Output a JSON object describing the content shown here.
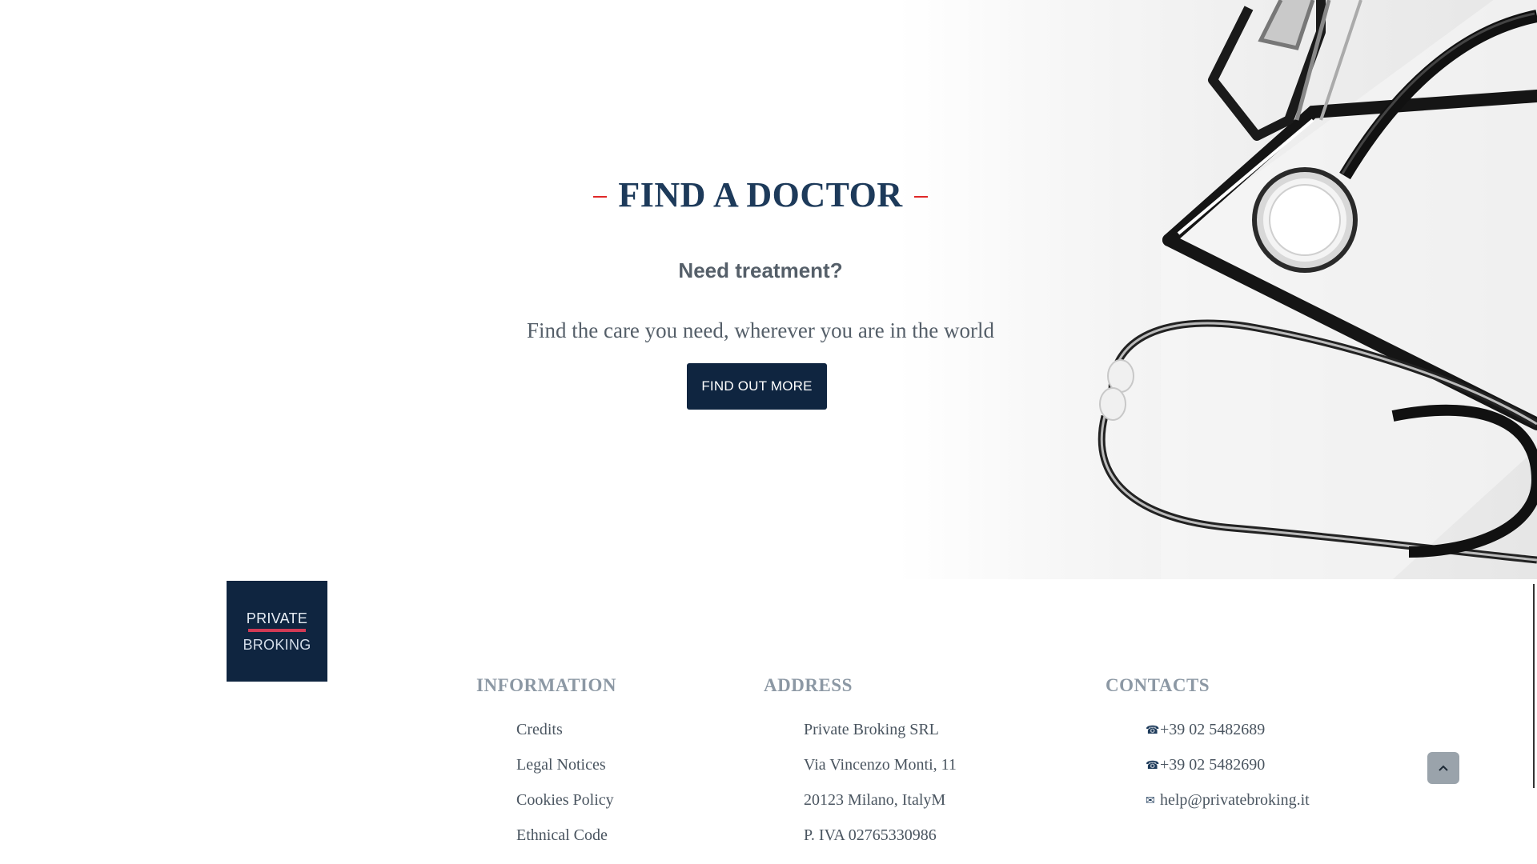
{
  "hero": {
    "title": "FIND A DOCTOR",
    "subtitle": "Need treatment?",
    "text": "Find the care you need, wherever you are in the world",
    "button_label": "FIND OUT MORE",
    "accent_color": "#e02828",
    "title_color": "#1d3a5a",
    "button_color": "#0f2540",
    "image_subject": "stethoscope-on-clipboard"
  },
  "footer": {
    "logo": {
      "line1": "PRIVATE",
      "line2": "BROKING"
    },
    "information": {
      "heading": "INFORMATION",
      "items": [
        "Credits",
        "Legal Notices",
        "Cookies Policy",
        "Ethnical Code"
      ]
    },
    "address": {
      "heading": "ADDRESS",
      "lines": [
        "Private Broking SRL",
        "Via Vincenzo Monti, 11",
        "20123 Milano, ItalyM",
        "P. IVA 02765330986"
      ]
    },
    "contacts": {
      "heading": "CONTACTS",
      "items": [
        {
          "icon": "phone-icon",
          "text": "+39 02 5482689"
        },
        {
          "icon": "phone-icon",
          "text": "+39 02 5482690"
        },
        {
          "icon": "envelope-icon",
          "text": "help@privatebroking.it"
        }
      ]
    }
  },
  "scroll_top": {
    "icon": "chevron-up-icon"
  }
}
